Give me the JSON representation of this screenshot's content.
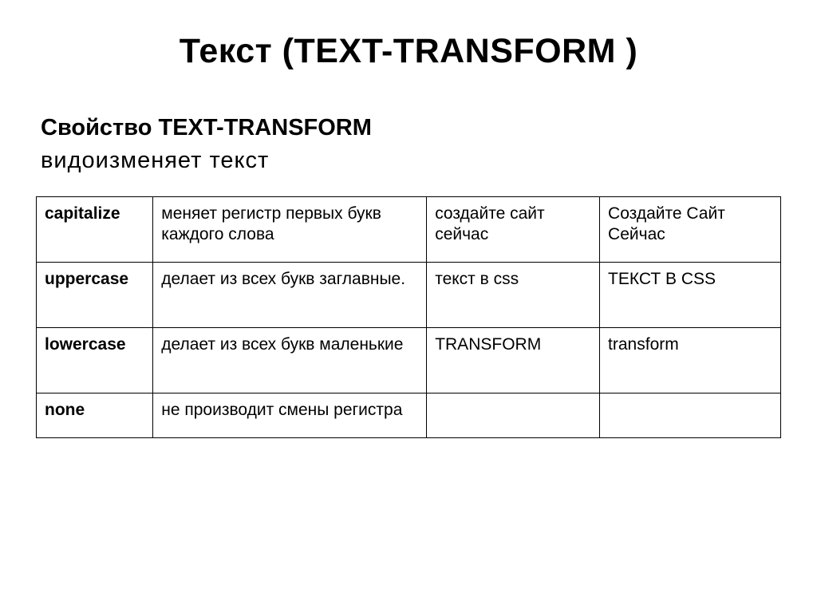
{
  "title": "Текст (TEXT-TRANSFORM )",
  "subheading": "Свойство TEXT-TRANSFORM",
  "subtext": "видоизменяет текст",
  "rows": [
    {
      "prop": "capitalize",
      "desc": "меняет регистр первых букв каждого слова",
      "input": "создайте сайт сейчас",
      "output": "Создайте Сайт Сейчас"
    },
    {
      "prop": "uppercase",
      "desc": "делает из всех букв заглавные.",
      "input": "текст в css",
      "output": "ТЕКСТ В CSS"
    },
    {
      "prop": "lowercase",
      "desc": "делает из всех букв маленькие",
      "input": "TRANSFORM",
      "output": "transform"
    },
    {
      "prop": "none",
      "desc": "не производит смены регистра",
      "input": "",
      "output": ""
    }
  ]
}
